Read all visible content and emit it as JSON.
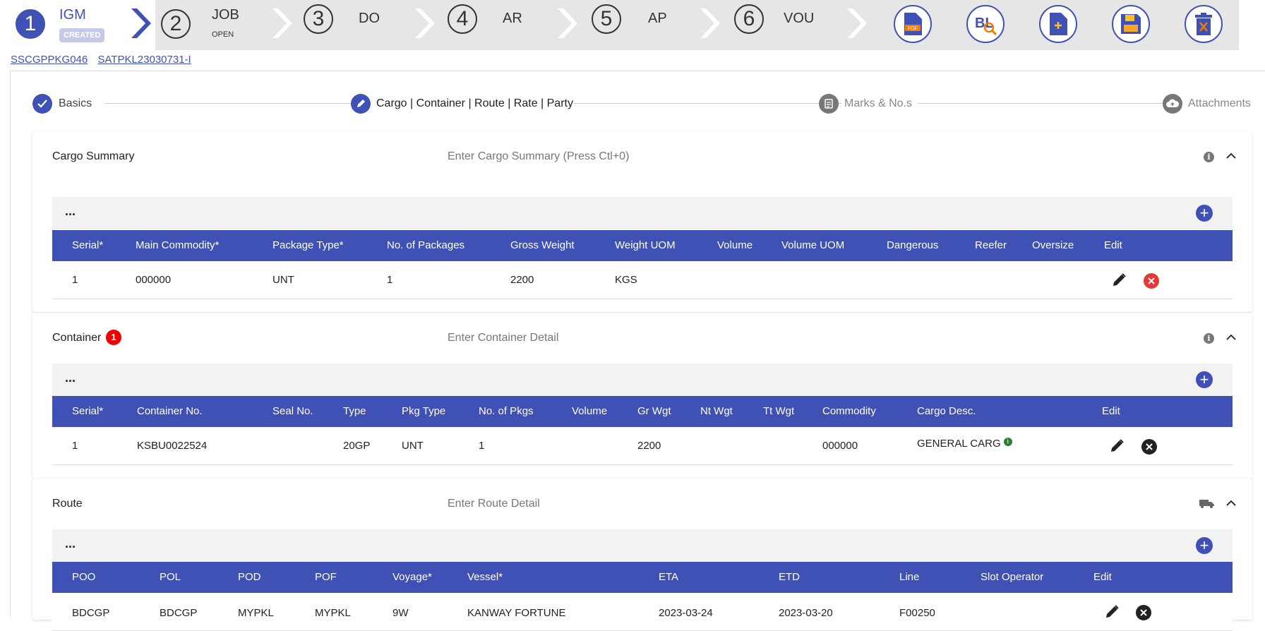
{
  "workflow": {
    "steps": [
      {
        "number": "1",
        "label": "IGM",
        "status": "CREATED"
      },
      {
        "number": "2",
        "label": "JOB",
        "status": "OPEN"
      },
      {
        "number": "3",
        "label": "DO",
        "status": ""
      },
      {
        "number": "4",
        "label": "AR",
        "status": ""
      },
      {
        "number": "5",
        "label": "AP",
        "status": ""
      },
      {
        "number": "6",
        "label": "VOU",
        "status": ""
      }
    ],
    "actions": [
      "pdf-file-icon",
      "bl-search-icon",
      "add-document-icon",
      "save-icon",
      "delete-icon"
    ]
  },
  "links": [
    "SSCGPPKG046",
    "SATPKL23030731-I"
  ],
  "stepper": [
    {
      "label": "Basics",
      "state": "done"
    },
    {
      "label": "Cargo | Container | Route | Rate | Party",
      "state": "active"
    },
    {
      "label": "Marks & No.s",
      "state": "pending"
    },
    {
      "label": "Attachments",
      "state": "pending"
    }
  ],
  "cargo": {
    "title": "Cargo Summary",
    "hint": "Enter Cargo Summary (Press Ctl+0)",
    "toolbar": "...",
    "columns": [
      "Serial*",
      "Main Commodity*",
      "Package Type*",
      "No. of Packages",
      "Gross Weight",
      "Weight UOM",
      "Volume",
      "Volume UOM",
      "Dangerous",
      "Reefer",
      "Oversize",
      "Edit"
    ],
    "rows": [
      [
        "1",
        "000000",
        "UNT",
        "1",
        "2200",
        "KGS",
        "",
        "",
        "",
        "",
        ""
      ]
    ]
  },
  "container": {
    "title": "Container",
    "badge": "1",
    "hint": "Enter Container Detail",
    "toolbar": "...",
    "columns": [
      "Serial*",
      "Container No.",
      "Seal No.",
      "Type",
      "Pkg Type",
      "No. of Pkgs",
      "Volume",
      "Gr Wgt",
      "Nt Wgt",
      "Tt Wgt",
      "Commodity",
      "Cargo Desc.",
      "Edit"
    ],
    "rows": [
      [
        "1",
        "KSBU0022524",
        "",
        "20GP",
        "UNT",
        "1",
        "",
        "2200",
        "",
        "",
        "000000",
        "GENERAL CARG"
      ]
    ]
  },
  "route": {
    "title": "Route",
    "hint": "Enter Route Detail",
    "toolbar": "...",
    "columns": [
      "POO",
      "POL",
      "POD",
      "POF",
      "Voyage*",
      "Vessel*",
      "ETA",
      "ETD",
      "Line",
      "Slot Operator",
      "Edit"
    ],
    "rows": [
      [
        "BDCGP",
        "BDCGP",
        "MYPKL",
        "MYPKL",
        "9W",
        "KANWAY FORTUNE",
        "2023-03-24",
        "2023-03-20",
        "F00250",
        ""
      ]
    ]
  },
  "colors": {
    "primary": "#3f51b5",
    "danger": "#e53935",
    "topbar": "#e6e6e6"
  }
}
